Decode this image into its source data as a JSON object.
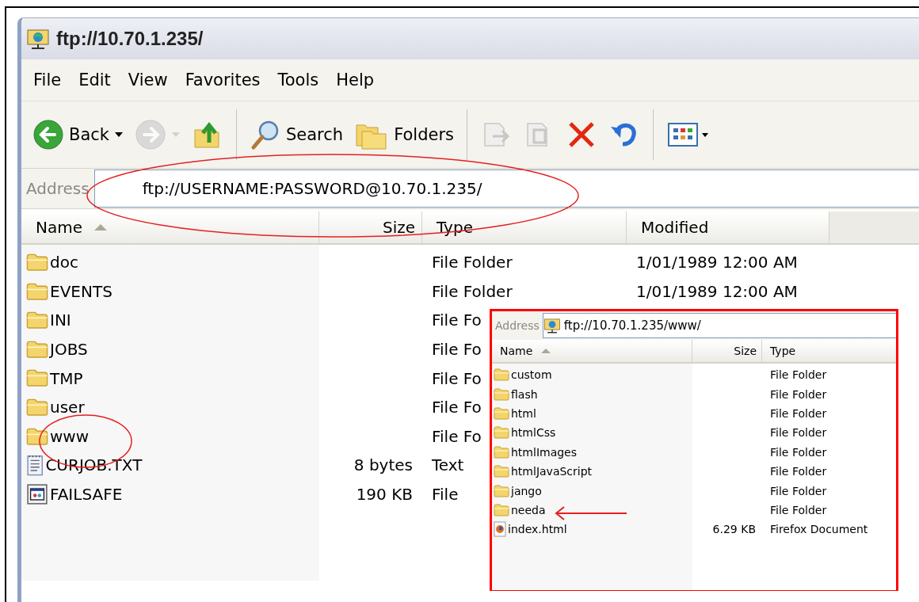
{
  "window": {
    "title": "ftp://10.70.1.235/"
  },
  "menu": [
    "File",
    "Edit",
    "View",
    "Favorites",
    "Tools",
    "Help"
  ],
  "toolbar": [
    {
      "kind": "back",
      "label": "Back",
      "disabled": false
    },
    {
      "kind": "forward",
      "disabled": true
    },
    {
      "kind": "up",
      "disabled": false
    },
    {
      "kind": "search",
      "label": "Search",
      "disabled": false
    },
    {
      "kind": "folders",
      "label": "Folders",
      "disabled": false
    },
    {
      "kind": "move",
      "disabled": true
    },
    {
      "kind": "copy",
      "disabled": true
    },
    {
      "kind": "delete",
      "disabled": false
    },
    {
      "kind": "undo",
      "disabled": false
    },
    {
      "kind": "views",
      "disabled": false
    }
  ],
  "address": {
    "label": "Address",
    "value": "ftp://USERNAME:PASSWORD@10.70.1.235/"
  },
  "columns": [
    {
      "label": "Name",
      "sorted": true
    },
    {
      "label": "Size",
      "sorted": false
    },
    {
      "label": "Type",
      "sorted": false
    },
    {
      "label": "Modified",
      "sorted": false
    }
  ],
  "rows": [
    {
      "kind": "folder",
      "name": "doc",
      "type": "File Folder",
      "modified": "1/01/1989 12:00 AM"
    },
    {
      "kind": "folder",
      "name": "EVENTS",
      "type": "File Folder",
      "modified": "1/01/1989 12:00 AM"
    },
    {
      "kind": "folder",
      "name": "INI",
      "type": "File Fo"
    },
    {
      "kind": "folder",
      "name": "JOBS",
      "type": "File Fo"
    },
    {
      "kind": "folder",
      "name": "TMP",
      "type": "File Fo"
    },
    {
      "kind": "folder",
      "name": "user",
      "type": "File Fo"
    },
    {
      "kind": "folder",
      "name": "www",
      "type": "File Fo"
    },
    {
      "kind": "text",
      "name": "CURJOB.TXT",
      "size": "8 bytes",
      "type": "Text"
    },
    {
      "kind": "app",
      "name": "FAILSAFE",
      "size": "190 KB",
      "type": "File"
    }
  ],
  "inset": {
    "address": {
      "label": "Address",
      "value": "ftp://10.70.1.235/www/"
    },
    "columns": [
      {
        "label": "Name",
        "sorted": true
      },
      {
        "label": "Size",
        "sorted": false
      },
      {
        "label": "Type",
        "sorted": false
      }
    ],
    "rows": [
      {
        "kind": "folder",
        "name": "custom",
        "type": "File Folder"
      },
      {
        "kind": "folder",
        "name": "flash",
        "type": "File Folder"
      },
      {
        "kind": "folder",
        "name": "html",
        "type": "File Folder"
      },
      {
        "kind": "folder",
        "name": "htmlCss",
        "type": "File Folder"
      },
      {
        "kind": "folder",
        "name": "htmlImages",
        "type": "File Folder"
      },
      {
        "kind": "folder",
        "name": "htmlJavaScript",
        "type": "File Folder"
      },
      {
        "kind": "folder",
        "name": "jango",
        "type": "File Folder"
      },
      {
        "kind": "folder",
        "name": "needa",
        "type": "File Folder"
      },
      {
        "kind": "firefox",
        "name": "index.html",
        "size": "6.29 KB",
        "type": "Firefox Document"
      }
    ]
  }
}
